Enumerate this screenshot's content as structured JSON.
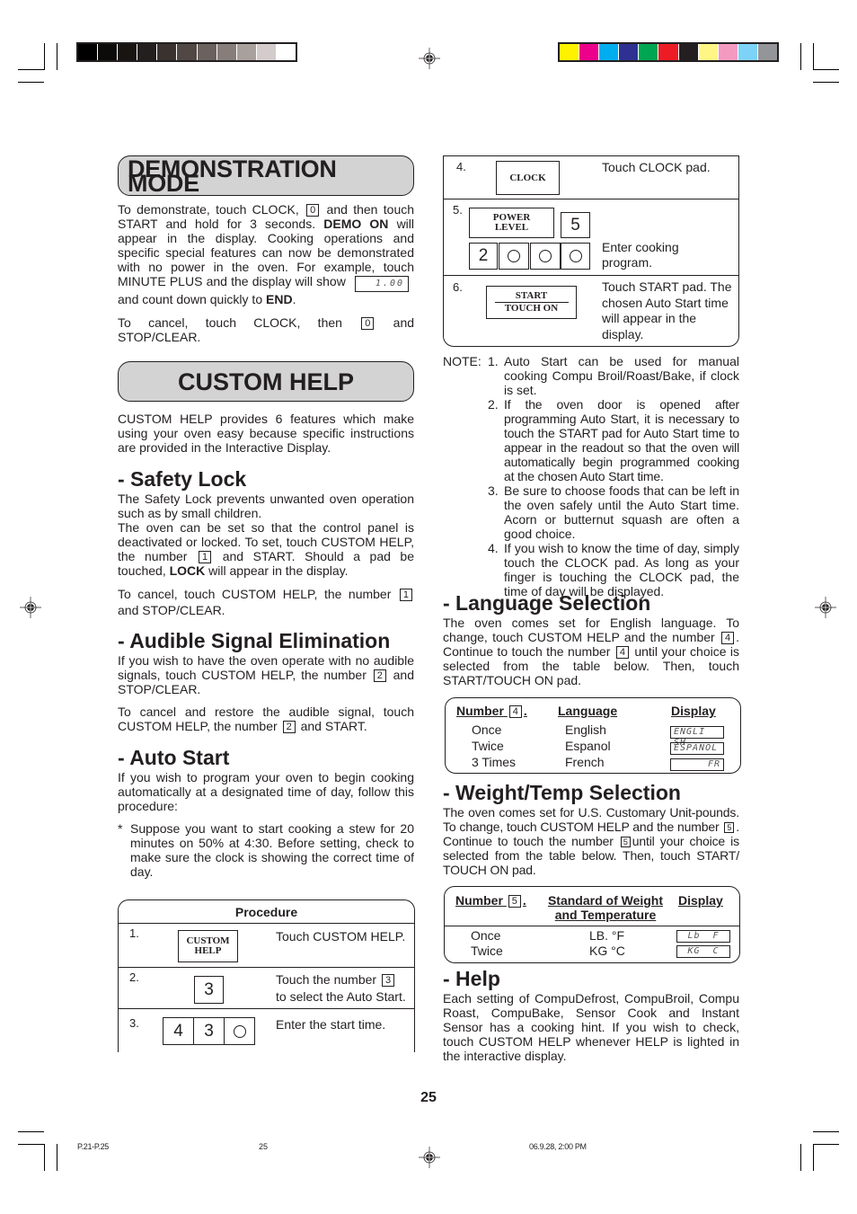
{
  "print_marks": {
    "grayscale_swatches": [
      "#000000",
      "#0d0b0a",
      "#181412",
      "#231f1e",
      "#3a322f",
      "#514845",
      "#6b625f",
      "#877e7b",
      "#a8a09d",
      "#d3cccb",
      "#ffffff"
    ],
    "color_swatches": [
      "#fff200",
      "#ec008c",
      "#00aeef",
      "#2e3192",
      "#00a651",
      "#ed1c24",
      "#231f20",
      "#fff685",
      "#f49ac1",
      "#7dd3f7",
      "#939598"
    ]
  },
  "demo": {
    "title": "DEMONSTRATION MODE",
    "p1_a": "To demonstrate, touch CLOCK,",
    "p1_key": "0",
    "p1_b": "and then touch START and hold for 3 seconds.",
    "p1_bold": "DEMO ON",
    "p1_c": "will appear in the display. Cooking operations and specific special features can now be demonstrated with no power in the oven. For example, touch MINUTE PLUS and the display will show",
    "p1_display": "1.00",
    "p1_d": "and count down quickly to",
    "p1_end": "END",
    "p2_a": "To cancel, touch CLOCK, then",
    "p2_key": "0",
    "p2_b": "and STOP/CLEAR."
  },
  "custom_help": {
    "title": "CUSTOM HELP",
    "intro": "CUSTOM HELP provides 6 features which make using your oven easy because specific instructions are provided in the Interactive Display."
  },
  "safety_lock": {
    "heading": "- Safety Lock",
    "p1": "The Safety Lock prevents unwanted oven operation such as by small children.",
    "p2_a": "The oven can be set so that the control panel is deactivated or locked. To set, touch CUSTOM HELP, the number",
    "p2_key": "1",
    "p2_b": "and START. Should a pad be touched,",
    "p2_bold": "LOCK",
    "p2_c": "will appear in the display.",
    "p3_a": "To cancel, touch CUSTOM HELP, the number",
    "p3_key": "1",
    "p3_b": "and STOP/CLEAR."
  },
  "audible": {
    "heading": "- Audible Signal Elimination",
    "p1_a": "If you wish to have the oven operate with no audible signals, touch CUSTOM HELP, the number",
    "p1_key": "2",
    "p1_b": "and STOP/CLEAR.",
    "p2_a": "To cancel and restore the audible signal, touch CUSTOM HELP, the number",
    "p2_key": "2",
    "p2_b": "and START."
  },
  "auto_start": {
    "heading": "- Auto Start",
    "p1": "If you wish to program your oven to begin cooking automatically at a designated time of day, follow this procedure:",
    "bullet": "*",
    "p2": "Suppose you want to start cooking a stew for 20 minutes on 50% at 4:30. Before setting, check to make sure the clock is showing the correct time of day."
  },
  "procedure": {
    "header": "Procedure",
    "steps": [
      {
        "num": "1.",
        "pad": [
          "CUSTOM",
          "HELP"
        ],
        "text": "Touch CUSTOM HELP."
      },
      {
        "num": "2.",
        "digits": [
          "3"
        ],
        "text_a": "Touch the number",
        "text_key": "3",
        "text_b": "to select the Auto Start."
      },
      {
        "num": "3.",
        "digits": [
          "4",
          "3",
          "○"
        ],
        "text": "Enter the start time."
      },
      {
        "num": "4.",
        "pad": [
          "CLOCK"
        ],
        "text": "Touch CLOCK pad."
      },
      {
        "num": "5.",
        "pad": [
          "POWER",
          "LEVEL"
        ],
        "pad_digit": "5",
        "digits": [
          "2",
          "○",
          "○",
          "○"
        ],
        "text": "Enter cooking program."
      },
      {
        "num": "6.",
        "pad": [
          "START",
          "TOUCH ON"
        ],
        "text": "Touch START pad. The chosen Auto Start time will appear in the display."
      }
    ]
  },
  "notes": {
    "label": "NOTE:",
    "items": [
      {
        "num": "1.",
        "text": "Auto Start can be used for manual cooking Compu Broil/Roast/Bake, if clock is set."
      },
      {
        "num": "2.",
        "text": "If the oven door is opened after programming Auto Start, it is necessary to touch the START pad for Auto Start time to appear in the readout so that the oven will automatically begin programmed cooking at the chosen Auto Start time."
      },
      {
        "num": "3.",
        "text": "Be sure to choose foods that can be left in the oven safely until the Auto Start time. Acorn or butternut squash are often a good choice."
      },
      {
        "num": "4.",
        "text": "If you wish to know the time of day, simply touch the CLOCK pad. As long as your finger is touching the CLOCK pad, the time of day will be displayed."
      }
    ]
  },
  "language": {
    "heading": "- Language Selection",
    "p_a": "The oven comes set for English language. To change, touch CUSTOM HELP and the number",
    "p_key1": "4",
    "p_b": ". Continue to touch the number",
    "p_key2": "4",
    "p_c": "until your choice is selected from the table below. Then, touch START/TOUCH ON pad.",
    "table": {
      "col_number": "Number",
      "col_number_key": "4",
      "col_language": "Language",
      "col_display": "Display",
      "rows": [
        {
          "number": "Once",
          "language": "English",
          "display": "ENGLI SH"
        },
        {
          "number": "Twice",
          "language": "Espanol",
          "display": "ESPANOL"
        },
        {
          "number": "3 Times",
          "language": "French",
          "display": "FR"
        }
      ]
    }
  },
  "weight": {
    "heading": "- Weight/Temp Selection",
    "p_a": "The oven comes set for U.S. Customary Unit-pounds. To change, touch CUSTOM HELP and the number",
    "p_key1": "5",
    "p_b": ". Continue to touch the number",
    "p_key2": "5",
    "p_c": "until your choice is selected from the table below. Then, touch START/ TOUCH ON pad.",
    "table": {
      "col_number": "Number",
      "col_number_key": "5",
      "col_standard_1": "Standard of  Weight",
      "col_standard_2": "and Temperature",
      "col_display": "Display",
      "rows": [
        {
          "number": "Once",
          "standard": "LB. °F",
          "display": "Lb  F"
        },
        {
          "number": "Twice",
          "standard": "KG °C",
          "display": "KG  C"
        }
      ]
    }
  },
  "help": {
    "heading": "- Help",
    "p": "Each setting of CompuDefrost, CompuBroil, Compu Roast, CompuBake, Sensor Cook and Instant Sensor has a cooking hint. If you wish to check, touch CUSTOM HELP whenever HELP is lighted in the interactive display."
  },
  "footer": {
    "page_number": "25",
    "slug_file": "P.21-P.25",
    "slug_page": "25",
    "slug_date": "06.9.28, 2:00 PM"
  }
}
